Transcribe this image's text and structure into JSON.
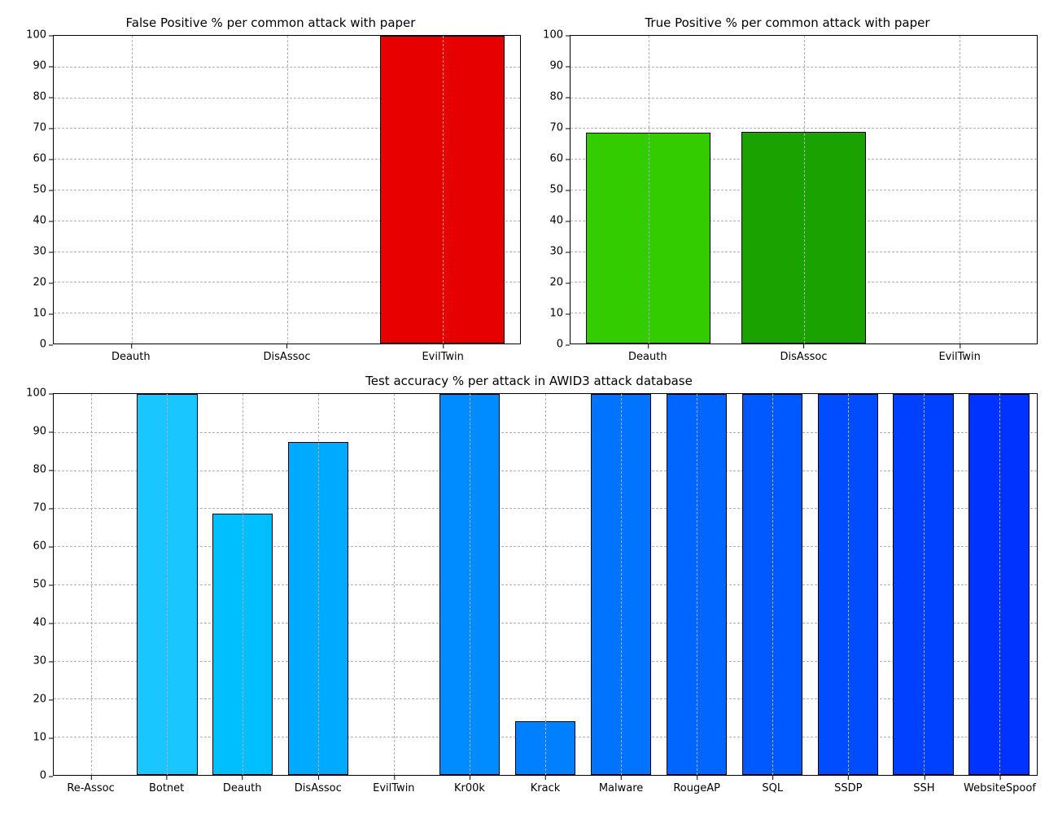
{
  "chart_data": [
    {
      "id": "fp",
      "type": "bar",
      "title": "False Positive % per common attack with paper",
      "categories": [
        "Deauth",
        "DisAssoc",
        "EvilTwin"
      ],
      "values": [
        0,
        0,
        100
      ],
      "colors": [
        "#ff6666",
        "#ff3333",
        "#e60000"
      ],
      "ylim": [
        0,
        100
      ],
      "yticks": [
        0,
        10,
        20,
        30,
        40,
        50,
        60,
        70,
        80,
        90,
        100
      ]
    },
    {
      "id": "tp",
      "type": "bar",
      "title": "True Positive % per common attack with paper",
      "categories": [
        "Deauth",
        "DisAssoc",
        "EvilTwin"
      ],
      "values": [
        68.5,
        68.7,
        0
      ],
      "colors": [
        "#33cc00",
        "#1aa300",
        "#007a00"
      ],
      "ylim": [
        0,
        100
      ],
      "yticks": [
        0,
        10,
        20,
        30,
        40,
        50,
        60,
        70,
        80,
        90,
        100
      ]
    },
    {
      "id": "acc",
      "type": "bar",
      "title": "Test accuracy % per attack in AWID3 attack database",
      "categories": [
        "Re-Assoc",
        "Botnet",
        "Deauth",
        "DisAssoc",
        "EvilTwin",
        "Kr00k",
        "Krack",
        "Malware",
        "RougeAP",
        "SQL",
        "SSDP",
        "SSH",
        "WebsiteSpoof"
      ],
      "values": [
        0,
        100,
        68.5,
        87.5,
        0,
        100,
        14,
        100,
        100,
        100,
        100,
        100,
        100
      ],
      "colors": [
        "#33ccff",
        "#1ac6ff",
        "#00bfff",
        "#00aaff",
        "#0099ff",
        "#008cff",
        "#007fff",
        "#0073ff",
        "#0066ff",
        "#0059ff",
        "#004dff",
        "#0040ff",
        "#0033ff"
      ],
      "ylim": [
        0,
        100
      ],
      "yticks": [
        0,
        10,
        20,
        30,
        40,
        50,
        60,
        70,
        80,
        90,
        100
      ]
    }
  ]
}
